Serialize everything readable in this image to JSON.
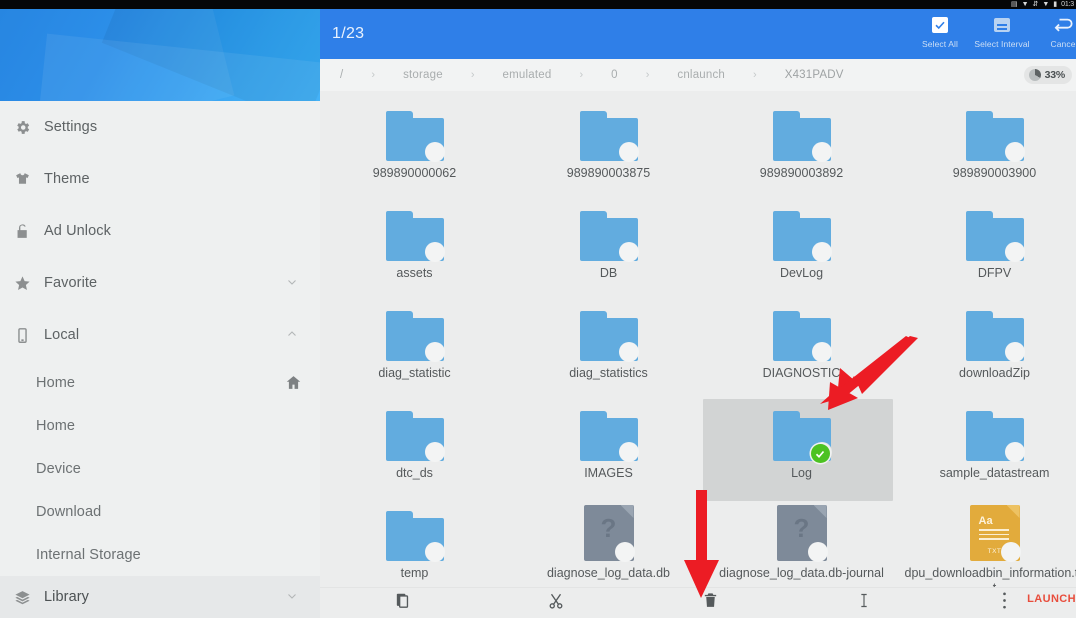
{
  "statusbar": {
    "icons": [
      "signal-icon",
      "wifi-icon",
      "bluetooth-icon",
      "wifi-icon-2",
      "battery-icon"
    ],
    "clock": "01:3"
  },
  "sidebar": {
    "items": [
      {
        "label": "Settings",
        "icon": "gear-icon",
        "trailing": "",
        "name": "settings"
      },
      {
        "label": "Theme",
        "icon": "tshirt-icon",
        "trailing": "",
        "name": "theme"
      },
      {
        "label": "Ad Unlock",
        "icon": "unlock-icon",
        "trailing": "",
        "name": "ad-unlock"
      },
      {
        "label": "Favorite",
        "icon": "star-icon",
        "trailing": "chevron-down-icon",
        "name": "favorite"
      },
      {
        "label": "Local",
        "icon": "phone-icon",
        "trailing": "chevron-up-icon",
        "name": "local"
      }
    ],
    "sub_items": [
      {
        "label": "Home",
        "trailing": "home-icon",
        "name": "home-root"
      },
      {
        "label": "Home",
        "trailing": "",
        "name": "home"
      },
      {
        "label": "Device",
        "trailing": "",
        "name": "device"
      },
      {
        "label": "Download",
        "trailing": "",
        "name": "download"
      },
      {
        "label": "Internal Storage",
        "trailing": "",
        "name": "internal-storage"
      }
    ],
    "library": {
      "label": "Library",
      "icon": "layers-icon",
      "trailing": "chevron-down-icon"
    }
  },
  "action_bar": {
    "selection_count": "1/23",
    "buttons": [
      {
        "label": "Select All",
        "icon": "checkbox-checked-icon",
        "name": "select-all"
      },
      {
        "label": "Select Interval",
        "icon": "select-interval-icon",
        "name": "select-interval"
      },
      {
        "label": "Cancel",
        "icon": "undo-arrow-icon",
        "name": "cancel"
      }
    ],
    "accent_color": "#2f7fe8"
  },
  "path_bar": {
    "crumbs": [
      "/",
      "storage",
      "emulated",
      "0",
      "cnlaunch",
      "X431PADV"
    ],
    "separator": "›",
    "battery": {
      "percent": "33%",
      "value": 33
    }
  },
  "grid": {
    "items": [
      {
        "name": "989890000062",
        "type": "folder",
        "selected": false
      },
      {
        "name": "989890003875",
        "type": "folder",
        "selected": false
      },
      {
        "name": "989890003892",
        "type": "folder",
        "selected": false
      },
      {
        "name": "989890003900",
        "type": "folder",
        "selected": false
      },
      {
        "name": "assets",
        "type": "folder",
        "selected": false
      },
      {
        "name": "DB",
        "type": "folder",
        "selected": false
      },
      {
        "name": "DevLog",
        "type": "folder",
        "selected": false
      },
      {
        "name": "DFPV",
        "type": "folder",
        "selected": false
      },
      {
        "name": "diag_statistic",
        "type": "folder",
        "selected": false
      },
      {
        "name": "diag_statistics",
        "type": "folder",
        "selected": false
      },
      {
        "name": "DIAGNOSTIC",
        "type": "folder",
        "selected": false
      },
      {
        "name": "downloadZip",
        "type": "folder",
        "selected": false
      },
      {
        "name": "dtc_ds",
        "type": "folder",
        "selected": false
      },
      {
        "name": "IMAGES",
        "type": "folder",
        "selected": false
      },
      {
        "name": "Log",
        "type": "folder",
        "selected": true
      },
      {
        "name": "sample_datastream",
        "type": "folder",
        "selected": false
      },
      {
        "name": "temp",
        "type": "folder",
        "selected": false
      },
      {
        "name": "diagnose_log_data.db",
        "type": "unknown-file",
        "selected": false
      },
      {
        "name": "diagnose_log_data.db-journal",
        "type": "unknown-file",
        "selected": false
      },
      {
        "name": "dpu_downloadbin_information.txt",
        "type": "text-file",
        "ext_label": "TXT",
        "aa_label": "Aa",
        "selected": false
      }
    ],
    "selection_highlight_color": "#d2d4d4",
    "check_badge_color": "#4cc222",
    "folder_color": "#62acdf"
  },
  "bottom_bar": {
    "buttons": [
      {
        "icon": "copy-icon",
        "name": "copy"
      },
      {
        "icon": "scissors-icon",
        "name": "cut"
      },
      {
        "icon": "trash-icon",
        "name": "delete"
      },
      {
        "icon": "text-cursor-icon",
        "name": "rename"
      },
      {
        "icon": "more-vertical-icon",
        "name": "more"
      }
    ],
    "watermark": "LAUNCH",
    "watermark_color": "#e8402e"
  },
  "annotations": {
    "arrows": [
      {
        "name": "arrow-to-log-folder",
        "color": "#ec1c24"
      },
      {
        "name": "arrow-to-delete-button",
        "color": "#ec1c24"
      }
    ]
  }
}
